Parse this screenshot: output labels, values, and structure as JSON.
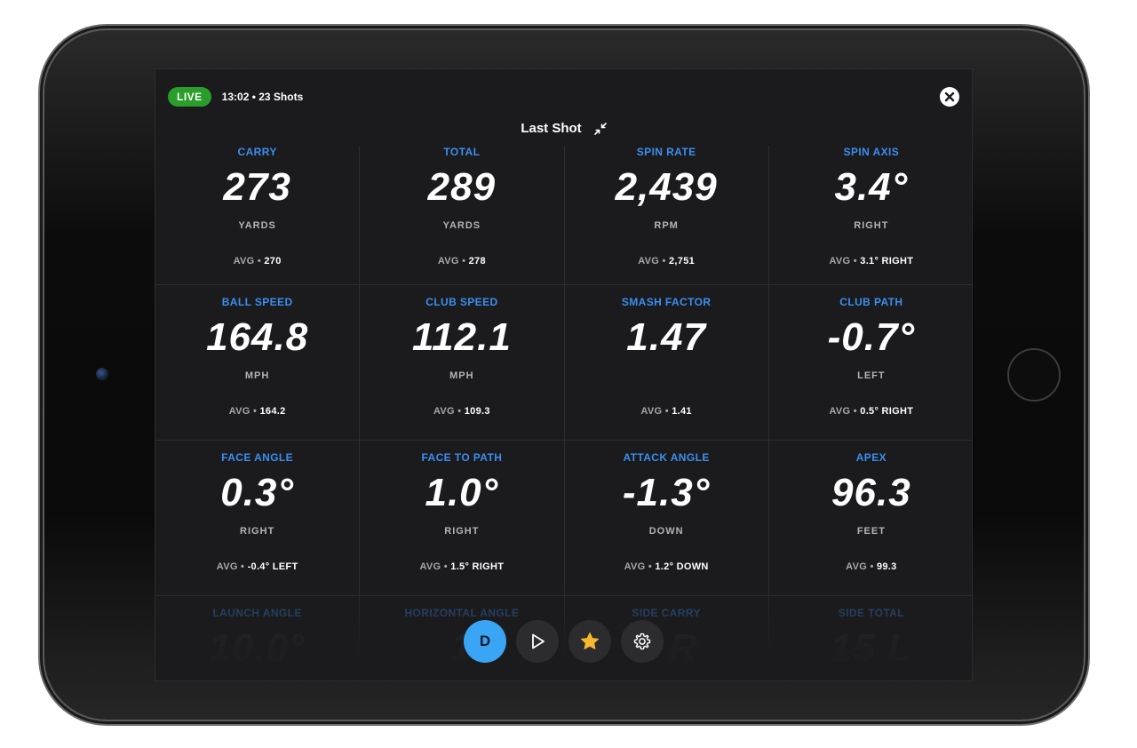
{
  "session": {
    "live_label": "LIVE",
    "info": "13:02 • 23 Shots"
  },
  "header": {
    "title": "Last Shot"
  },
  "metrics": [
    {
      "label": "CARRY",
      "value": "273",
      "unit": "YARDS",
      "avg_prefix": "AVG • ",
      "avg_value": "270"
    },
    {
      "label": "TOTAL",
      "value": "289",
      "unit": "YARDS",
      "avg_prefix": "AVG • ",
      "avg_value": "278"
    },
    {
      "label": "SPIN RATE",
      "value": "2,439",
      "unit": "RPM",
      "avg_prefix": "AVG • ",
      "avg_value": "2,751"
    },
    {
      "label": "SPIN AXIS",
      "value": "3.4°",
      "unit": "RIGHT",
      "avg_prefix": "AVG • ",
      "avg_value": "3.1° RIGHT"
    },
    {
      "label": "BALL SPEED",
      "value": "164.8",
      "unit": "MPH",
      "avg_prefix": "AVG • ",
      "avg_value": "164.2"
    },
    {
      "label": "CLUB SPEED",
      "value": "112.1",
      "unit": "MPH",
      "avg_prefix": "AVG • ",
      "avg_value": "109.3"
    },
    {
      "label": "SMASH FACTOR",
      "value": "1.47",
      "unit": "",
      "avg_prefix": "AVG • ",
      "avg_value": "1.41"
    },
    {
      "label": "CLUB PATH",
      "value": "-0.7°",
      "unit": "LEFT",
      "avg_prefix": "AVG • ",
      "avg_value": "0.5° RIGHT"
    },
    {
      "label": "FACE ANGLE",
      "value": "0.3°",
      "unit": "RIGHT",
      "avg_prefix": "AVG • ",
      "avg_value": "-0.4° LEFT"
    },
    {
      "label": "FACE TO PATH",
      "value": "1.0°",
      "unit": "RIGHT",
      "avg_prefix": "AVG • ",
      "avg_value": "1.5° RIGHT"
    },
    {
      "label": "ATTACK ANGLE",
      "value": "-1.3°",
      "unit": "DOWN",
      "avg_prefix": "AVG • ",
      "avg_value": "1.2° DOWN"
    },
    {
      "label": "APEX",
      "value": "96.3",
      "unit": "FEET",
      "avg_prefix": "AVG • ",
      "avg_value": "99.3"
    },
    {
      "label": "LAUNCH ANGLE",
      "value": "10.0°",
      "unit": "",
      "avg_prefix": "",
      "avg_value": ""
    },
    {
      "label": "HORIZONTAL ANGLE",
      "value": "1",
      "unit": "",
      "avg_prefix": "",
      "avg_value": ""
    },
    {
      "label": "SIDE CARRY",
      "value": "3 R",
      "unit": "",
      "avg_prefix": "",
      "avg_value": ""
    },
    {
      "label": "SIDE TOTAL",
      "value": "15 L",
      "unit": "",
      "avg_prefix": "",
      "avg_value": ""
    }
  ],
  "dock": {
    "club_label": "D",
    "icons": [
      "play-icon",
      "star-icon",
      "gear-icon"
    ]
  },
  "colors": {
    "accent_blue": "#3b8ef0",
    "live_green": "#2a9d2a",
    "club_button": "#3aa5f5",
    "star_yellow": "#f5b82e",
    "screen_bg": "#1b1b1d"
  }
}
